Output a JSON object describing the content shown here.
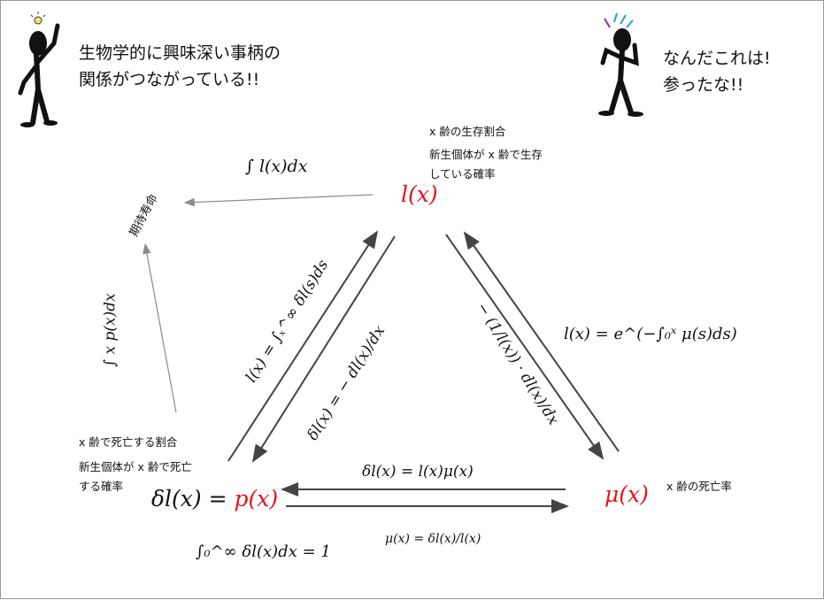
{
  "speech": {
    "left_line1": "生物学的に興味深い事柄の",
    "left_line2": "関係がつながっている!!",
    "right_line1": "なんだこれは!",
    "right_line2": "参ったな!!"
  },
  "nodes": {
    "lx": "l(x)",
    "mux": "μ(x)",
    "px_left": "δl(x) = ",
    "px_right": "p(x)",
    "life_expectancy": "期待寿命"
  },
  "notes": {
    "lx_line1": "x 齢の生存割合",
    "lx_line2": "新生個体が x 齢で生存",
    "lx_line3": "している確率",
    "px_line1": "x 齢で死亡する割合",
    "px_line2": "新生個体が x 齢で死亡",
    "px_line3": "する確率",
    "mux": "x 齢の死亡率"
  },
  "equations": {
    "integral_lx": "∫ l(x)dx",
    "integral_xpx": "∫ x p(x)dx",
    "lx_from_delta": "l(x) = ∫ₓ^∞ δl(s)ds",
    "delta_from_lx": "δl(x) = − dl(x)/dx",
    "mu_from_lx": "− (1/l(x)) · dl(x)/dx",
    "lx_from_mu": "l(x) = e^(−∫₀ˣ μ(s)ds)",
    "delta_from_mu": "δl(x) = l(x)μ(x)",
    "mu_from_delta": "μ(x) = δl(x)/l(x)",
    "delta_integral": "∫₀^∞ δl(x)dx = 1"
  },
  "colors": {
    "accent_red": "#e3141a",
    "arrow_dark": "#444444",
    "arrow_gray": "#8a8a8a"
  },
  "icons": [
    "person-idea-icon",
    "person-confused-icon",
    "lightbulb-icon"
  ]
}
